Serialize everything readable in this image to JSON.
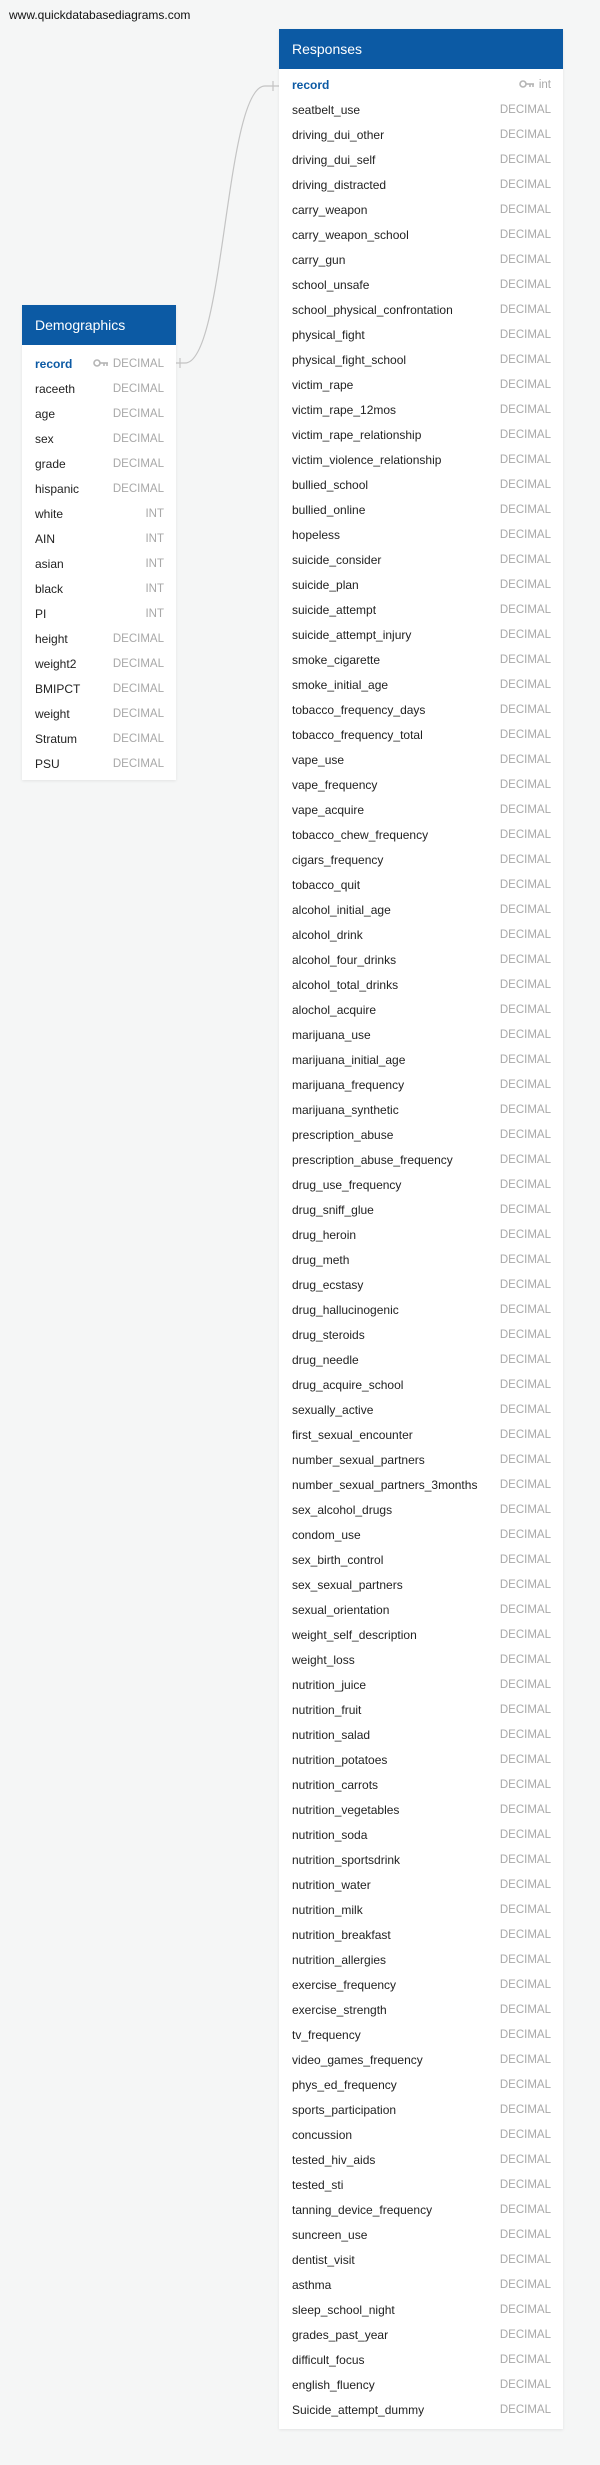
{
  "site": {
    "url": "www.quickdatabasediagrams.com"
  },
  "tables": {
    "demographics": {
      "title": "Demographics",
      "columns": [
        {
          "name": "record",
          "type": "DECIMAL",
          "pk": true
        },
        {
          "name": "raceeth",
          "type": "DECIMAL"
        },
        {
          "name": "age",
          "type": "DECIMAL"
        },
        {
          "name": "sex",
          "type": "DECIMAL"
        },
        {
          "name": "grade",
          "type": "DECIMAL"
        },
        {
          "name": "hispanic",
          "type": "DECIMAL"
        },
        {
          "name": "white",
          "type": "INT"
        },
        {
          "name": "AIN",
          "type": "INT"
        },
        {
          "name": "asian",
          "type": "INT"
        },
        {
          "name": "black",
          "type": "INT"
        },
        {
          "name": "PI",
          "type": "INT"
        },
        {
          "name": "height",
          "type": "DECIMAL"
        },
        {
          "name": "weight2",
          "type": "DECIMAL"
        },
        {
          "name": "BMIPCT",
          "type": "DECIMAL"
        },
        {
          "name": "weight",
          "type": "DECIMAL"
        },
        {
          "name": "Stratum",
          "type": "DECIMAL"
        },
        {
          "name": "PSU",
          "type": "DECIMAL"
        }
      ]
    },
    "responses": {
      "title": "Responses",
      "columns": [
        {
          "name": "record",
          "type": "int",
          "pk": true
        },
        {
          "name": "seatbelt_use",
          "type": "DECIMAL"
        },
        {
          "name": "driving_dui_other",
          "type": "DECIMAL"
        },
        {
          "name": "driving_dui_self",
          "type": "DECIMAL"
        },
        {
          "name": "driving_distracted",
          "type": "DECIMAL"
        },
        {
          "name": "carry_weapon",
          "type": "DECIMAL"
        },
        {
          "name": "carry_weapon_school",
          "type": "DECIMAL"
        },
        {
          "name": "carry_gun",
          "type": "DECIMAL"
        },
        {
          "name": "school_unsafe",
          "type": "DECIMAL"
        },
        {
          "name": "school_physical_confrontation",
          "type": "DECIMAL"
        },
        {
          "name": "physical_fight",
          "type": "DECIMAL"
        },
        {
          "name": "physical_fight_school",
          "type": "DECIMAL"
        },
        {
          "name": "victim_rape",
          "type": "DECIMAL"
        },
        {
          "name": "victim_rape_12mos",
          "type": "DECIMAL"
        },
        {
          "name": "victim_rape_relationship",
          "type": "DECIMAL"
        },
        {
          "name": "victim_violence_relationship",
          "type": "DECIMAL"
        },
        {
          "name": "bullied_school",
          "type": "DECIMAL"
        },
        {
          "name": "bullied_online",
          "type": "DECIMAL"
        },
        {
          "name": "hopeless",
          "type": "DECIMAL"
        },
        {
          "name": "suicide_consider",
          "type": "DECIMAL"
        },
        {
          "name": "suicide_plan",
          "type": "DECIMAL"
        },
        {
          "name": "suicide_attempt",
          "type": "DECIMAL"
        },
        {
          "name": "suicide_attempt_injury",
          "type": "DECIMAL"
        },
        {
          "name": "smoke_cigarette",
          "type": "DECIMAL"
        },
        {
          "name": "smoke_initial_age",
          "type": "DECIMAL"
        },
        {
          "name": "tobacco_frequency_days",
          "type": "DECIMAL"
        },
        {
          "name": "tobacco_frequency_total",
          "type": "DECIMAL"
        },
        {
          "name": "vape_use",
          "type": "DECIMAL"
        },
        {
          "name": "vape_frequency",
          "type": "DECIMAL"
        },
        {
          "name": "vape_acquire",
          "type": "DECIMAL"
        },
        {
          "name": "tobacco_chew_frequency",
          "type": "DECIMAL"
        },
        {
          "name": "cigars_frequency",
          "type": "DECIMAL"
        },
        {
          "name": "tobacco_quit",
          "type": "DECIMAL"
        },
        {
          "name": "alcohol_initial_age",
          "type": "DECIMAL"
        },
        {
          "name": "alcohol_drink",
          "type": "DECIMAL"
        },
        {
          "name": "alcohol_four_drinks",
          "type": "DECIMAL"
        },
        {
          "name": "alcohol_total_drinks",
          "type": "DECIMAL"
        },
        {
          "name": "alochol_acquire",
          "type": "DECIMAL"
        },
        {
          "name": "marijuana_use",
          "type": "DECIMAL"
        },
        {
          "name": "marijuana_initial_age",
          "type": "DECIMAL"
        },
        {
          "name": "marijuana_frequency",
          "type": "DECIMAL"
        },
        {
          "name": "marijuana_synthetic",
          "type": "DECIMAL"
        },
        {
          "name": "prescription_abuse",
          "type": "DECIMAL"
        },
        {
          "name": "prescription_abuse_frequency",
          "type": "DECIMAL"
        },
        {
          "name": "drug_use_frequency",
          "type": "DECIMAL"
        },
        {
          "name": "drug_sniff_glue",
          "type": "DECIMAL"
        },
        {
          "name": "drug_heroin",
          "type": "DECIMAL"
        },
        {
          "name": "drug_meth",
          "type": "DECIMAL"
        },
        {
          "name": "drug_ecstasy",
          "type": "DECIMAL"
        },
        {
          "name": "drug_hallucinogenic",
          "type": "DECIMAL"
        },
        {
          "name": "drug_steroids",
          "type": "DECIMAL"
        },
        {
          "name": "drug_needle",
          "type": "DECIMAL"
        },
        {
          "name": "drug_acquire_school",
          "type": "DECIMAL"
        },
        {
          "name": "sexually_active",
          "type": "DECIMAL"
        },
        {
          "name": "first_sexual_encounter",
          "type": "DECIMAL"
        },
        {
          "name": "number_sexual_partners",
          "type": "DECIMAL"
        },
        {
          "name": "number_sexual_partners_3months",
          "type": "DECIMAL"
        },
        {
          "name": "sex_alcohol_drugs",
          "type": "DECIMAL"
        },
        {
          "name": "condom_use",
          "type": "DECIMAL"
        },
        {
          "name": "sex_birth_control",
          "type": "DECIMAL"
        },
        {
          "name": "sex_sexual_partners",
          "type": "DECIMAL"
        },
        {
          "name": "sexual_orientation",
          "type": "DECIMAL"
        },
        {
          "name": "weight_self_description",
          "type": "DECIMAL"
        },
        {
          "name": "weight_loss",
          "type": "DECIMAL"
        },
        {
          "name": "nutrition_juice",
          "type": "DECIMAL"
        },
        {
          "name": "nutrition_fruit",
          "type": "DECIMAL"
        },
        {
          "name": "nutrition_salad",
          "type": "DECIMAL"
        },
        {
          "name": "nutrition_potatoes",
          "type": "DECIMAL"
        },
        {
          "name": "nutrition_carrots",
          "type": "DECIMAL"
        },
        {
          "name": "nutrition_vegetables",
          "type": "DECIMAL"
        },
        {
          "name": "nutrition_soda",
          "type": "DECIMAL"
        },
        {
          "name": "nutrition_sportsdrink",
          "type": "DECIMAL"
        },
        {
          "name": "nutrition_water",
          "type": "DECIMAL"
        },
        {
          "name": "nutrition_milk",
          "type": "DECIMAL"
        },
        {
          "name": "nutrition_breakfast",
          "type": "DECIMAL"
        },
        {
          "name": "nutrition_allergies",
          "type": "DECIMAL"
        },
        {
          "name": "exercise_frequency",
          "type": "DECIMAL"
        },
        {
          "name": "exercise_strength",
          "type": "DECIMAL"
        },
        {
          "name": "tv_frequency",
          "type": "DECIMAL"
        },
        {
          "name": "video_games_frequency",
          "type": "DECIMAL"
        },
        {
          "name": "phys_ed_frequency",
          "type": "DECIMAL"
        },
        {
          "name": "sports_participation",
          "type": "DECIMAL"
        },
        {
          "name": "concussion",
          "type": "DECIMAL"
        },
        {
          "name": "tested_hiv_aids",
          "type": "DECIMAL"
        },
        {
          "name": "tested_sti",
          "type": "DECIMAL"
        },
        {
          "name": "tanning_device_frequency",
          "type": "DECIMAL"
        },
        {
          "name": "suncreen_use",
          "type": "DECIMAL"
        },
        {
          "name": "dentist_visit",
          "type": "DECIMAL"
        },
        {
          "name": "asthma",
          "type": "DECIMAL"
        },
        {
          "name": "sleep_school_night",
          "type": "DECIMAL"
        },
        {
          "name": "grades_past_year",
          "type": "DECIMAL"
        },
        {
          "name": "difficult_focus",
          "type": "DECIMAL"
        },
        {
          "name": "english_fluency",
          "type": "DECIMAL"
        },
        {
          "name": "Suicide_attempt_dummy",
          "type": "DECIMAL"
        }
      ]
    }
  },
  "colors": {
    "header": "#0c5aa4",
    "pk_text": "#0c5aa4",
    "type_text": "#a8a8a8",
    "connector": "#c4c4c4"
  },
  "icons": {
    "primary_key": "key-icon"
  }
}
